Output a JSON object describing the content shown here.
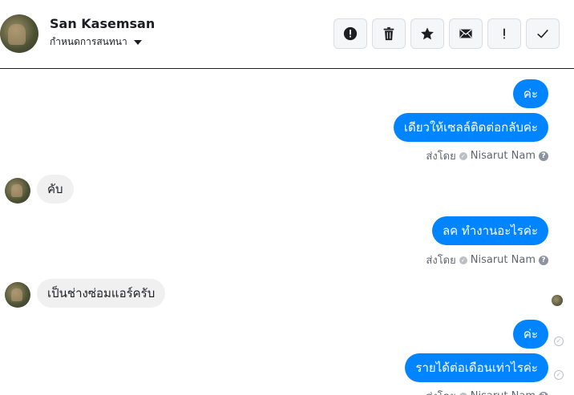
{
  "header": {
    "contact_name": "San Kasemsan",
    "subtitle": "กำหนดการสนทนา",
    "tools": [
      {
        "name": "mark-spam-button",
        "icon": "alert-circle-icon"
      },
      {
        "name": "delete-button",
        "icon": "trash-icon"
      },
      {
        "name": "star-button",
        "icon": "star-icon"
      },
      {
        "name": "mark-unread-button",
        "icon": "envelope-icon"
      },
      {
        "name": "follow-up-button",
        "icon": "exclamation-icon"
      },
      {
        "name": "mark-done-button",
        "icon": "check-icon"
      }
    ]
  },
  "messages": {
    "out1": "ค่ะ",
    "out2": "เดียวให้เซลล์ติดต่อกลับค่ะ",
    "in1": "คับ",
    "out3": "ลค ทำงานอะไรค่ะ",
    "in2": "เป็นช่างซ่อมแอร์ครับ",
    "out4": "ค่ะ",
    "out5": "รายได้ต่อเดือนเท่าไรค่ะ"
  },
  "sent_by": {
    "prefix": "ส่งโดย",
    "agent": "Nisarut Nam",
    "help": "?"
  },
  "colors": {
    "outgoing_bubble": "#0084ff",
    "incoming_bubble": "#f0f0f0"
  }
}
